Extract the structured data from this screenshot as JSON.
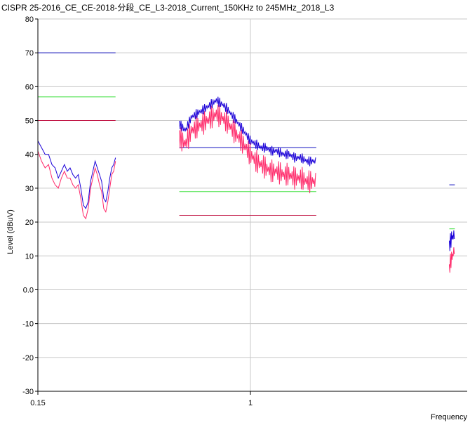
{
  "chart_data": {
    "type": "line",
    "title": "CISPR 25-2016_CE_CE-2018-分段_CE_L3-2018_Current_150KHz to 245MHz_2018_L3",
    "xlabel": "Frequency",
    "ylabel": "Level (dBuV)",
    "x_scale": "log",
    "ylim": [
      -30,
      80
    ],
    "yticks": [
      80,
      70,
      60,
      50,
      40,
      30,
      20,
      10,
      0.0,
      -10,
      -20,
      -30
    ],
    "ytick_labels": [
      "80",
      "70",
      "60",
      "50",
      "40",
      "30",
      "20",
      "10",
      "0.0",
      "-10",
      "-20",
      "-30"
    ],
    "xticks": [
      0.15,
      1
    ],
    "xtick_labels": [
      "0.15",
      "1"
    ],
    "grid": true,
    "colors": {
      "peak": "#1a00d8",
      "average": "#ff2a6a",
      "limit_blue": "#1010c0",
      "limit_green": "#40e040",
      "limit_red": "#c01040",
      "grid": "#c8c8c8"
    },
    "limit_lines": [
      {
        "color_key": "limit_blue",
        "x": [
          0.15,
          0.3
        ],
        "y": 70
      },
      {
        "color_key": "limit_green",
        "x": [
          0.15,
          0.3
        ],
        "y": 57
      },
      {
        "color_key": "limit_red",
        "x": [
          0.15,
          0.3
        ],
        "y": 50
      },
      {
        "color_key": "limit_blue",
        "x": [
          0.53,
          1.8
        ],
        "y": 42
      },
      {
        "color_key": "limit_green",
        "x": [
          0.53,
          1.8
        ],
        "y": 29
      },
      {
        "color_key": "limit_red",
        "x": [
          0.53,
          1.8
        ],
        "y": 22
      },
      {
        "color_key": "limit_blue",
        "x": [
          5.9,
          6.2
        ],
        "y": 31
      },
      {
        "color_key": "limit_green",
        "x": [
          5.9,
          6.2
        ],
        "y": 18
      }
    ],
    "series": [
      {
        "color_key": "peak",
        "segments": [
          {
            "x": [
              0.15,
              0.155,
              0.16,
              0.165,
              0.17,
              0.175,
              0.18,
              0.185,
              0.19,
              0.195,
              0.2,
              0.205,
              0.21,
              0.215,
              0.22,
              0.225,
              0.23,
              0.235,
              0.24,
              0.245,
              0.25,
              0.255,
              0.26,
              0.265,
              0.27,
              0.275,
              0.28,
              0.285,
              0.29,
              0.295,
              0.3
            ],
            "y": [
              44,
              42,
              40,
              40,
              37,
              36,
              33,
              35,
              37,
              35,
              36,
              34,
              33,
              34,
              30,
              25,
              24,
              26,
              32,
              35,
              38,
              36,
              34,
              32,
              27,
              26,
              29,
              33,
              36,
              37,
              39
            ]
          },
          {
            "x": [
              0.53,
              0.56,
              0.59,
              0.62,
              0.65,
              0.68,
              0.71,
              0.74,
              0.77,
              0.8,
              0.84,
              0.88,
              0.92,
              0.96,
              1.0,
              1.05,
              1.1,
              1.15,
              1.2,
              1.27,
              1.34,
              1.41,
              1.49,
              1.57,
              1.65,
              1.73,
              1.8
            ],
            "y": [
              49,
              47,
              51,
              52,
              53,
              54,
              55,
              56,
              55,
              54,
              52,
              50,
              48,
              46,
              44,
              43,
              42,
              42,
              41,
              41,
              40,
              40,
              39,
              39,
              38,
              38,
              38
            ]
          },
          {
            "x": [
              5.9,
              5.95,
              6.0,
              6.05,
              6.1,
              6.15,
              6.2
            ],
            "y": [
              13,
              14,
              15,
              16,
              15,
              17,
              16
            ]
          }
        ]
      },
      {
        "color_key": "average",
        "segments": [
          {
            "x": [
              0.15,
              0.155,
              0.16,
              0.165,
              0.17,
              0.175,
              0.18,
              0.185,
              0.19,
              0.195,
              0.2,
              0.205,
              0.21,
              0.215,
              0.22,
              0.225,
              0.23,
              0.235,
              0.24,
              0.245,
              0.25,
              0.255,
              0.26,
              0.265,
              0.27,
              0.275,
              0.28,
              0.285,
              0.29,
              0.295,
              0.3
            ],
            "y": [
              41,
              38,
              36,
              37,
              33,
              31,
              30,
              33,
              35,
              33,
              33,
              31,
              30,
              31,
              27,
              22,
              21,
              24,
              30,
              33,
              36,
              34,
              31,
              29,
              24,
              23,
              26,
              30,
              34,
              35,
              38
            ]
          },
          {
            "x": [
              0.53,
              0.56,
              0.59,
              0.62,
              0.65,
              0.68,
              0.71,
              0.74,
              0.77,
              0.8,
              0.84,
              0.88,
              0.92,
              0.96,
              1.0,
              1.05,
              1.1,
              1.15,
              1.2,
              1.27,
              1.34,
              1.41,
              1.49,
              1.57,
              1.65,
              1.73,
              1.8
            ],
            "y": [
              45,
              43,
              47,
              48,
              49,
              50,
              51,
              52,
              51,
              50,
              48,
              46,
              44,
              42,
              40,
              38,
              37,
              36,
              35,
              35,
              34,
              34,
              33,
              33,
              32,
              32,
              32
            ]
          },
          {
            "x": [
              5.9,
              5.95,
              6.0,
              6.05,
              6.1,
              6.15,
              6.2
            ],
            "y": [
              6,
              8,
              9,
              10,
              10,
              12,
              12
            ]
          }
        ]
      }
    ]
  }
}
